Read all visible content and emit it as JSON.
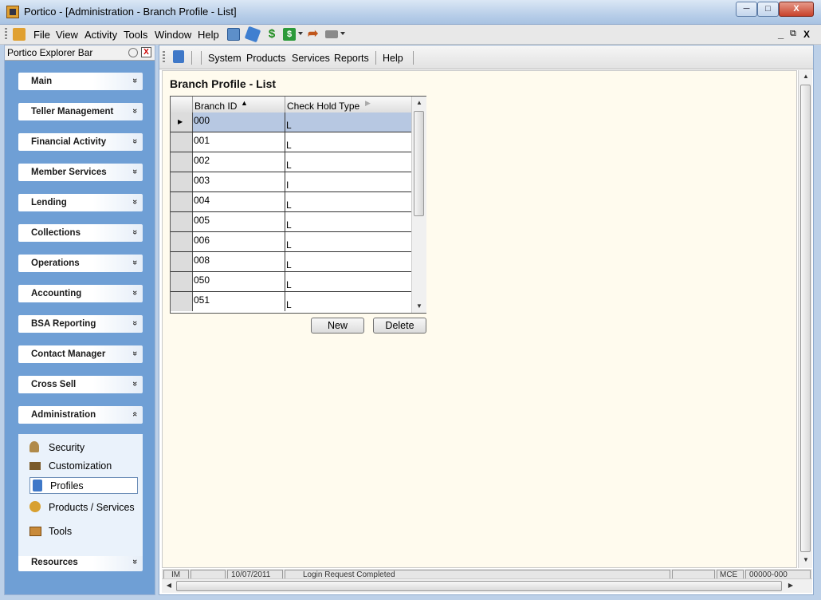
{
  "window": {
    "title": "Portico - [Administration - Branch Profile - List]",
    "close_glyph": "X"
  },
  "menubar": {
    "items": [
      "File",
      "View",
      "Activity",
      "Tools",
      "Window",
      "Help"
    ],
    "toolbar_icons": [
      "network-icon",
      "transfer-icon",
      "dollar-icon",
      "deposit-icon",
      "forward-arrow-icon",
      "printer-icon"
    ],
    "mdi_controls": [
      "_",
      "⧉",
      "X"
    ]
  },
  "explorer": {
    "title": "Portico Explorer Bar",
    "close_glyph": "X",
    "sections": [
      "Main",
      "Teller Management",
      "Financial Activity",
      "Member Services",
      "Lending",
      "Collections",
      "Operations",
      "Accounting",
      "BSA Reporting",
      "Contact Manager",
      "Cross Sell",
      "Administration",
      "Resources"
    ],
    "collapsed_chevron": "»",
    "expanded_chevron": "«",
    "admin_items": [
      {
        "label": "Security",
        "icon": "keys-icon"
      },
      {
        "label": "Customization",
        "icon": "tools-icon"
      },
      {
        "label": "Profiles",
        "icon": "profile-icon"
      },
      {
        "label": "Products / Services",
        "icon": "products-icon"
      },
      {
        "label": "Tools",
        "icon": "toolbox-icon"
      }
    ]
  },
  "nav": {
    "items": [
      "System",
      "Products",
      "Services",
      "Reports",
      "Help"
    ]
  },
  "page": {
    "title": "Branch Profile - List"
  },
  "grid": {
    "columns": [
      "Branch ID",
      "Check Hold Type"
    ],
    "sort_glyph": "▲",
    "rows": [
      {
        "id": "000",
        "type": "L"
      },
      {
        "id": "001",
        "type": "L"
      },
      {
        "id": "002",
        "type": "L"
      },
      {
        "id": "003",
        "type": "I"
      },
      {
        "id": "004",
        "type": "L"
      },
      {
        "id": "005",
        "type": "L"
      },
      {
        "id": "006",
        "type": "L"
      },
      {
        "id": "008",
        "type": "L"
      },
      {
        "id": "050",
        "type": "L"
      },
      {
        "id": "051",
        "type": "L"
      }
    ],
    "current_row_glyph": "▶"
  },
  "buttons": {
    "new": "New",
    "delete": "Delete"
  },
  "status": {
    "panels": [
      "IM",
      "",
      "10/07/2011",
      "Login Request Completed",
      "",
      "MCE",
      "00000-000"
    ]
  },
  "colors": {
    "panel_blue": "#6f9fd5",
    "selected_row": "#b7c8e2",
    "content_bg": "#fffbee"
  }
}
